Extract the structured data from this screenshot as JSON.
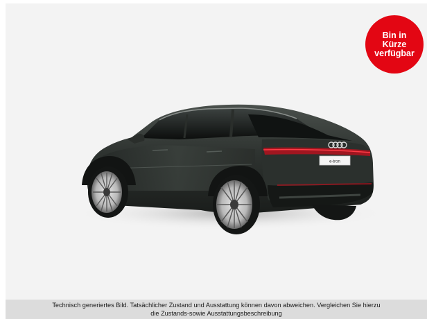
{
  "badge": {
    "lines": [
      "Bin in",
      "Kürze",
      "verfügbar"
    ],
    "color": "#e30613"
  },
  "car": {
    "image_icon": "car-rear-three-quarter-image",
    "plate_text": "e-tron",
    "body_color": "#2c302d"
  },
  "disclaimer": {
    "line1": "Technisch generiertes Bild. Tatsächlicher Zustand und Ausstattung können davon abweichen. Vergleichen Sie hierzu",
    "line2": "die Zustands-sowie Ausstattungsbeschreibung"
  }
}
